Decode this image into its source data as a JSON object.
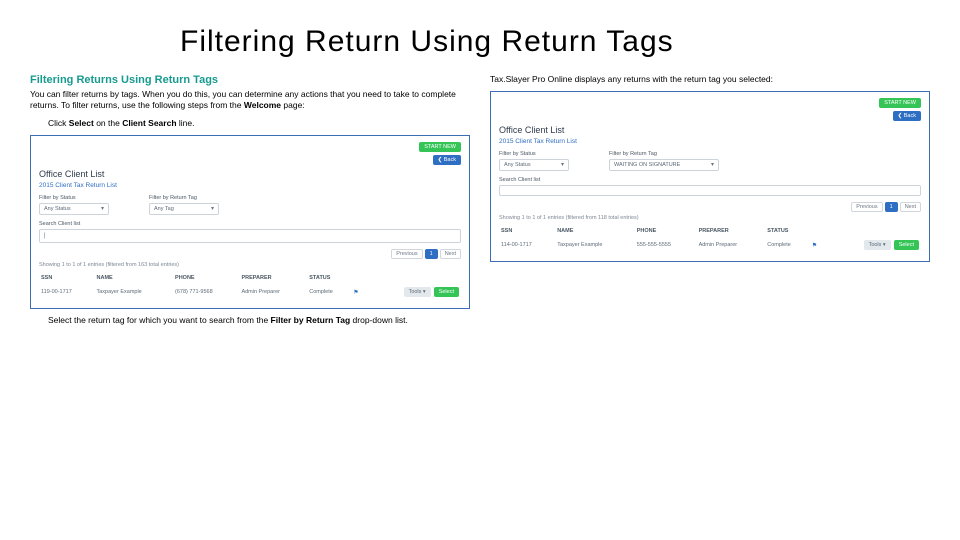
{
  "slide_title": "Filtering Return Using Return Tags",
  "left": {
    "heading": "Filtering Returns Using Return Tags",
    "intro_pre": "You can filter returns by tags. When you do this, you can determine any actions that you need to take to complete returns. To filter returns, use the following steps from the ",
    "intro_bold": "Welcome",
    "intro_post": " page:",
    "step1_pre": "Click ",
    "step1_b1": "Select",
    "step1_mid": " on the ",
    "step1_b2": "Client Search",
    "step1_post": " line.",
    "note_pre": "Select the return tag for which you want to search from the ",
    "note_b": "Filter by Return Tag",
    "note_post": " drop-down list."
  },
  "right_intro": "Tax.Slayer Pro Online displays any returns with the return tag you selected:",
  "panel_common": {
    "start_new_btn": "START NEW",
    "back_btn": "❮ Back",
    "heading": "Office Client List",
    "sub": "2015 Client Tax Return List",
    "filter_status_label": "Filter by Status",
    "filter_tag_label": "Filter by Return Tag",
    "search_label": "Search Client list",
    "prev": "Previous",
    "page": "1",
    "next": "Next",
    "cols": {
      "ssn": "SSN",
      "name": "NAME",
      "phone": "PHONE",
      "preparer": "PREPARER",
      "status": "STATUS"
    },
    "tools_btn": "Tools ▾",
    "select_btn": "Select"
  },
  "panelA": {
    "status_value": "Any Status",
    "tag_value": "Any Tag",
    "search_value": "|",
    "showing": "Showing 1 to 1 of 1 entries (filtered from 163 total entries)",
    "row": {
      "ssn": "119-00-1717",
      "name": "Taxpayer Example",
      "phone": "(678) 771-9568",
      "preparer": "Admin Preparer",
      "status": "Complete"
    }
  },
  "panelB": {
    "status_value": "Any Status",
    "tag_value": "WAITING ON SIGNATURE",
    "search_value": "",
    "showing": "Showing 1 to 1 of 1 entries (filtered from 118 total entries)",
    "row": {
      "ssn": "114-00-1717",
      "name": "Taxpayer Example",
      "phone": "555-555-5555",
      "preparer": "Admin Preparer",
      "status": "Complete"
    }
  }
}
